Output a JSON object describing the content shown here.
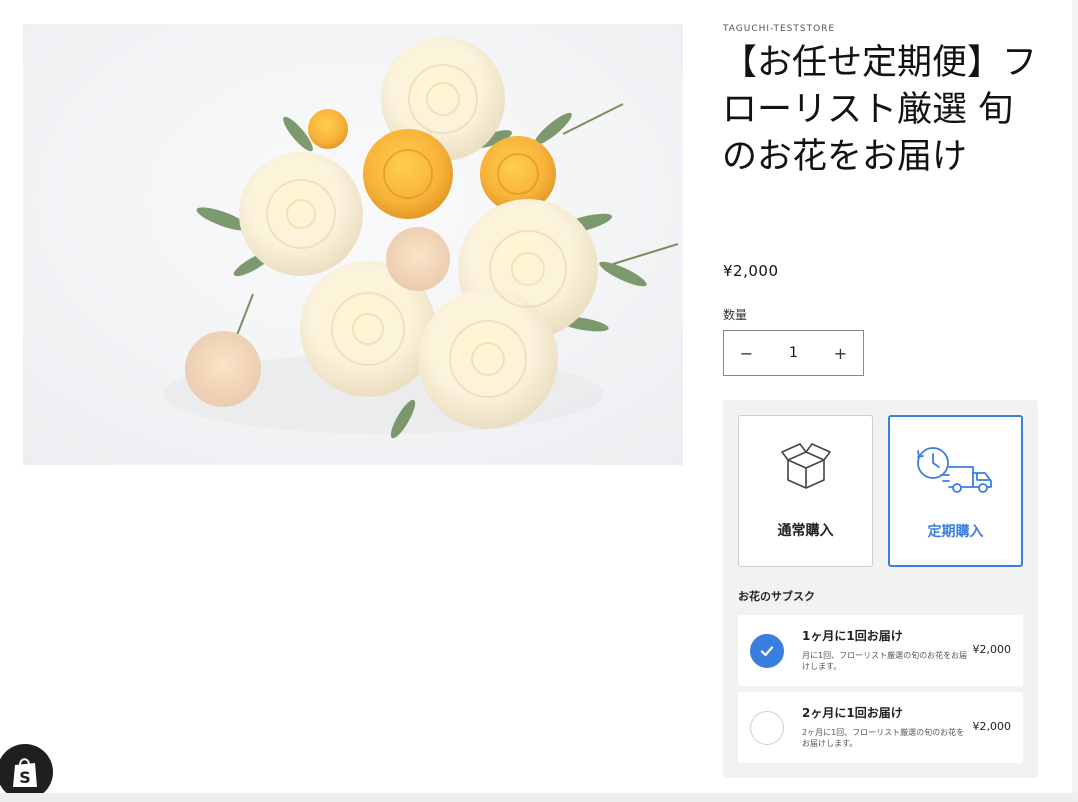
{
  "product": {
    "vendor": "TAGUCHI-TESTSTORE",
    "title": "【お任せ定期便】フローリスト厳選 旬のお花をお届け",
    "price": "¥2,000",
    "image_alt": "flower-bouquet-photo"
  },
  "quantity": {
    "label": "数量",
    "value": "1",
    "minus": "−",
    "plus": "+"
  },
  "purchase_options": {
    "one_time_label": "通常購入",
    "subscription_label": "定期購入",
    "selected": "subscription"
  },
  "subscription": {
    "heading": "お花のサブスク",
    "options": [
      {
        "title": "1ヶ月に1回お届け",
        "description": "月に1回、フローリスト厳選の旬のお花をお届けします。",
        "price": "¥2,000",
        "selected": true
      },
      {
        "title": "2ヶ月に1回お届け",
        "description": "2ヶ月に1回、フローリスト厳選の旬のお花をお届けします。",
        "price": "¥2,000",
        "selected": false
      }
    ]
  },
  "theme": {
    "accent": "#3a7ee0",
    "widget_bg": "#f2f2f2",
    "text": "#121212"
  },
  "icons": {
    "one_time": "box-icon",
    "subscription": "delivery-truck-clock-icon",
    "check": "check-icon",
    "badge": "shopify-bag-icon"
  }
}
